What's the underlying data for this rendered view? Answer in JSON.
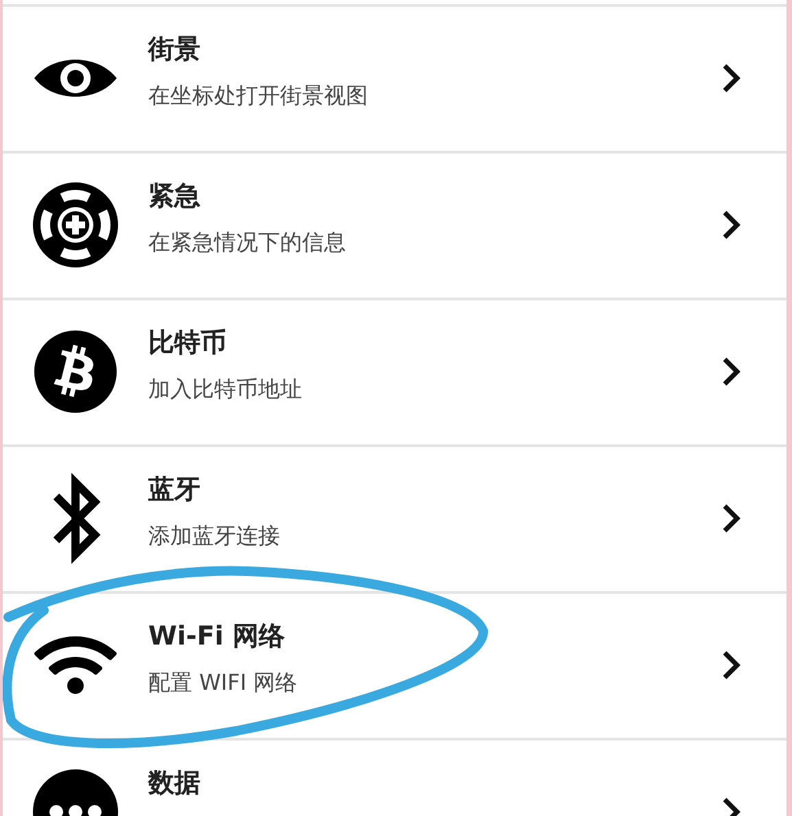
{
  "items": [
    {
      "kind": "eye",
      "title": "街景",
      "subtitle": "在坐标处打开街景视图",
      "highlighted": false
    },
    {
      "kind": "lifebuoy",
      "title": "紧急",
      "subtitle": "在紧急情况下的信息",
      "highlighted": false
    },
    {
      "kind": "bitcoin",
      "title": "比特币",
      "subtitle": "加入比特币地址",
      "highlighted": false
    },
    {
      "kind": "bluetooth",
      "title": "蓝牙",
      "subtitle": "添加蓝牙连接",
      "highlighted": false
    },
    {
      "kind": "wifi",
      "title": "Wi-Fi 网络",
      "subtitle": "配置 WIFI 网络",
      "highlighted": true
    },
    {
      "kind": "dots",
      "title": "数据",
      "highlighted": false
    }
  ]
}
